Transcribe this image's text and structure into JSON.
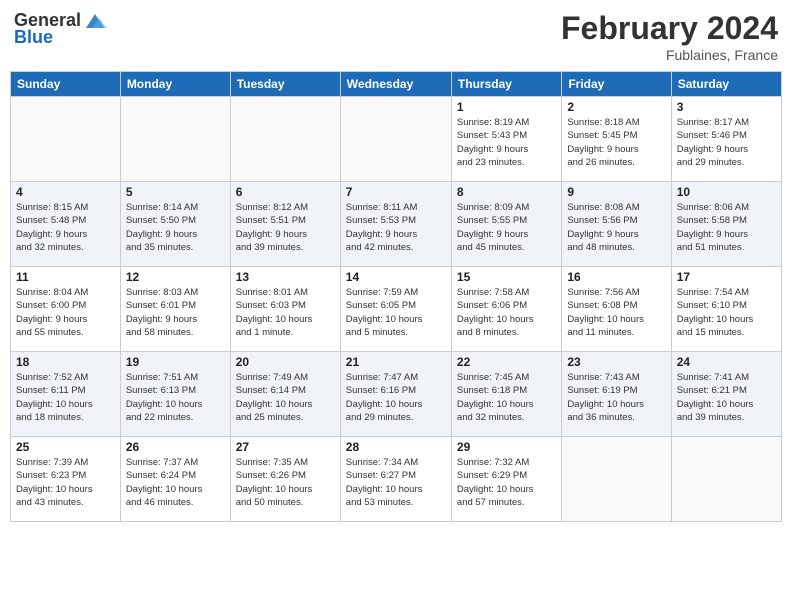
{
  "header": {
    "logo_general": "General",
    "logo_blue": "Blue",
    "title": "February 2024",
    "location": "Fublaines, France"
  },
  "columns": [
    "Sunday",
    "Monday",
    "Tuesday",
    "Wednesday",
    "Thursday",
    "Friday",
    "Saturday"
  ],
  "weeks": [
    {
      "days": [
        {
          "num": "",
          "info": ""
        },
        {
          "num": "",
          "info": ""
        },
        {
          "num": "",
          "info": ""
        },
        {
          "num": "",
          "info": ""
        },
        {
          "num": "1",
          "info": "Sunrise: 8:19 AM\nSunset: 5:43 PM\nDaylight: 9 hours\nand 23 minutes."
        },
        {
          "num": "2",
          "info": "Sunrise: 8:18 AM\nSunset: 5:45 PM\nDaylight: 9 hours\nand 26 minutes."
        },
        {
          "num": "3",
          "info": "Sunrise: 8:17 AM\nSunset: 5:46 PM\nDaylight: 9 hours\nand 29 minutes."
        }
      ]
    },
    {
      "days": [
        {
          "num": "4",
          "info": "Sunrise: 8:15 AM\nSunset: 5:48 PM\nDaylight: 9 hours\nand 32 minutes."
        },
        {
          "num": "5",
          "info": "Sunrise: 8:14 AM\nSunset: 5:50 PM\nDaylight: 9 hours\nand 35 minutes."
        },
        {
          "num": "6",
          "info": "Sunrise: 8:12 AM\nSunset: 5:51 PM\nDaylight: 9 hours\nand 39 minutes."
        },
        {
          "num": "7",
          "info": "Sunrise: 8:11 AM\nSunset: 5:53 PM\nDaylight: 9 hours\nand 42 minutes."
        },
        {
          "num": "8",
          "info": "Sunrise: 8:09 AM\nSunset: 5:55 PM\nDaylight: 9 hours\nand 45 minutes."
        },
        {
          "num": "9",
          "info": "Sunrise: 8:08 AM\nSunset: 5:56 PM\nDaylight: 9 hours\nand 48 minutes."
        },
        {
          "num": "10",
          "info": "Sunrise: 8:06 AM\nSunset: 5:58 PM\nDaylight: 9 hours\nand 51 minutes."
        }
      ]
    },
    {
      "days": [
        {
          "num": "11",
          "info": "Sunrise: 8:04 AM\nSunset: 6:00 PM\nDaylight: 9 hours\nand 55 minutes."
        },
        {
          "num": "12",
          "info": "Sunrise: 8:03 AM\nSunset: 6:01 PM\nDaylight: 9 hours\nand 58 minutes."
        },
        {
          "num": "13",
          "info": "Sunrise: 8:01 AM\nSunset: 6:03 PM\nDaylight: 10 hours\nand 1 minute."
        },
        {
          "num": "14",
          "info": "Sunrise: 7:59 AM\nSunset: 6:05 PM\nDaylight: 10 hours\nand 5 minutes."
        },
        {
          "num": "15",
          "info": "Sunrise: 7:58 AM\nSunset: 6:06 PM\nDaylight: 10 hours\nand 8 minutes."
        },
        {
          "num": "16",
          "info": "Sunrise: 7:56 AM\nSunset: 6:08 PM\nDaylight: 10 hours\nand 11 minutes."
        },
        {
          "num": "17",
          "info": "Sunrise: 7:54 AM\nSunset: 6:10 PM\nDaylight: 10 hours\nand 15 minutes."
        }
      ]
    },
    {
      "days": [
        {
          "num": "18",
          "info": "Sunrise: 7:52 AM\nSunset: 6:11 PM\nDaylight: 10 hours\nand 18 minutes."
        },
        {
          "num": "19",
          "info": "Sunrise: 7:51 AM\nSunset: 6:13 PM\nDaylight: 10 hours\nand 22 minutes."
        },
        {
          "num": "20",
          "info": "Sunrise: 7:49 AM\nSunset: 6:14 PM\nDaylight: 10 hours\nand 25 minutes."
        },
        {
          "num": "21",
          "info": "Sunrise: 7:47 AM\nSunset: 6:16 PM\nDaylight: 10 hours\nand 29 minutes."
        },
        {
          "num": "22",
          "info": "Sunrise: 7:45 AM\nSunset: 6:18 PM\nDaylight: 10 hours\nand 32 minutes."
        },
        {
          "num": "23",
          "info": "Sunrise: 7:43 AM\nSunset: 6:19 PM\nDaylight: 10 hours\nand 36 minutes."
        },
        {
          "num": "24",
          "info": "Sunrise: 7:41 AM\nSunset: 6:21 PM\nDaylight: 10 hours\nand 39 minutes."
        }
      ]
    },
    {
      "days": [
        {
          "num": "25",
          "info": "Sunrise: 7:39 AM\nSunset: 6:23 PM\nDaylight: 10 hours\nand 43 minutes."
        },
        {
          "num": "26",
          "info": "Sunrise: 7:37 AM\nSunset: 6:24 PM\nDaylight: 10 hours\nand 46 minutes."
        },
        {
          "num": "27",
          "info": "Sunrise: 7:35 AM\nSunset: 6:26 PM\nDaylight: 10 hours\nand 50 minutes."
        },
        {
          "num": "28",
          "info": "Sunrise: 7:34 AM\nSunset: 6:27 PM\nDaylight: 10 hours\nand 53 minutes."
        },
        {
          "num": "29",
          "info": "Sunrise: 7:32 AM\nSunset: 6:29 PM\nDaylight: 10 hours\nand 57 minutes."
        },
        {
          "num": "",
          "info": ""
        },
        {
          "num": "",
          "info": ""
        }
      ]
    }
  ]
}
